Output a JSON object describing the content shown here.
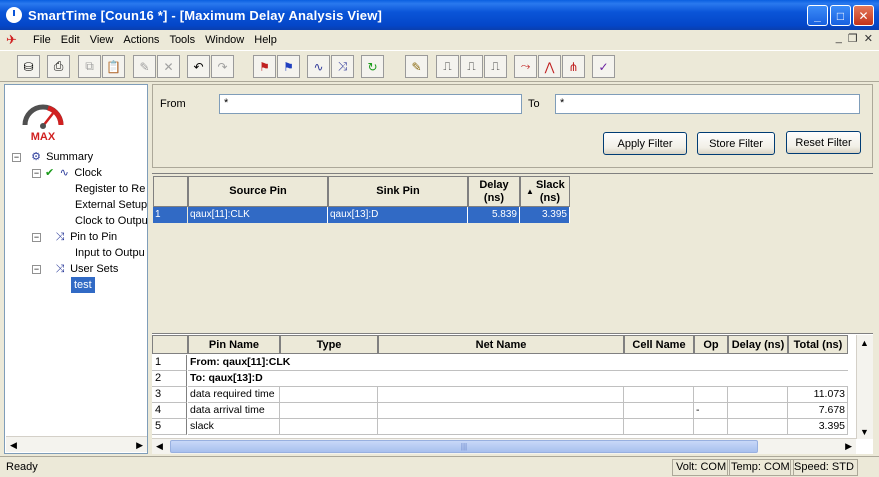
{
  "window": {
    "title": "SmartTime [Coun16 *] - [Maximum Delay Analysis View]",
    "buttons": {
      "minimize": "_",
      "maximize": "□",
      "close": "✕"
    }
  },
  "menu": {
    "items": [
      "File",
      "Edit",
      "View",
      "Actions",
      "Tools",
      "Window",
      "Help"
    ],
    "mdi": {
      "minimize": "_",
      "restore": "❐",
      "close": "✕"
    }
  },
  "toolbar": {
    "icons": [
      "open-db-icon",
      "print-icon",
      "copy-icon",
      "paste-icon",
      "edit-icon",
      "delete-icon",
      "undo-icon",
      "redo-icon",
      "max-delay-icon",
      "min-delay-icon",
      "clock-icon",
      "path-icon",
      "refresh-icon",
      "constraint-icon",
      "waveform-icon",
      "setup-icon",
      "hold-icon",
      "false-path-icon",
      "multicycle-icon",
      "max-path-icon",
      "check-icon"
    ]
  },
  "sidebar": {
    "gauge_label": "MAX",
    "tree": {
      "summary": "Summary",
      "clock": "Clock",
      "register_to_register": "Register to Re",
      "external_setup": "External Setup",
      "clock_to_output": "Clock to Outpu",
      "pin_to_pin": "Pin to Pin",
      "input_to_output": "Input to Outpu",
      "user_sets": "User Sets",
      "test": "test"
    }
  },
  "filter": {
    "from_label": "From",
    "from_value": "*",
    "to_label": "To",
    "to_value": "*",
    "apply_label": "Apply Filter",
    "store_label": "Store Filter",
    "reset_label": "Reset Filter"
  },
  "paths": {
    "headers": {
      "source_pin": "Source Pin",
      "sink_pin": "Sink Pin",
      "delay": "Delay (ns)",
      "slack": "Slack (ns)"
    },
    "sort_indicator": "▲",
    "rows": [
      {
        "index": "1",
        "source_pin": "qaux[11]:CLK",
        "sink_pin": "qaux[13]:D",
        "delay": "5.839",
        "slack": "3.395"
      }
    ]
  },
  "details": {
    "headers": {
      "pin_name": "Pin Name",
      "type": "Type",
      "net_name": "Net Name",
      "cell_name": "Cell Name",
      "op": "Op",
      "delay": "Delay (ns)",
      "total": "Total (ns)"
    },
    "rows": [
      {
        "index": "1",
        "pin_name": "From: qaux[11]:CLK",
        "op": "",
        "total": ""
      },
      {
        "index": "2",
        "pin_name": "To: qaux[13]:D",
        "op": "",
        "total": ""
      },
      {
        "index": "3",
        "pin_name": "data required time",
        "op": "",
        "total": "11.073"
      },
      {
        "index": "4",
        "pin_name": "data arrival time",
        "op": "-",
        "total": "7.678"
      },
      {
        "index": "5",
        "pin_name": "slack",
        "op": "",
        "total": "3.395"
      }
    ]
  },
  "statusbar": {
    "text": "Ready",
    "volt": "Volt: COM",
    "temp": "Temp: COM",
    "speed": "Speed: STD"
  }
}
